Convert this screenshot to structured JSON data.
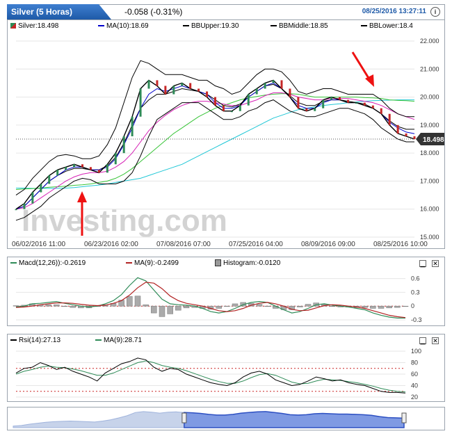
{
  "header": {
    "tab": "Silver (5 Horas)",
    "change": "-0.058 (-0.31%)",
    "datetime": "08/25/2016 13:27:11"
  },
  "main_legend": {
    "price": "Silver:18.498",
    "ma": "MA(10):18.69",
    "bbu": "BBUpper:19.30",
    "bbm": "BBMiddle:18.85",
    "bbl": "BBLower:18.4"
  },
  "macd_legend": {
    "macd": "Macd(12,26)):-0.2619",
    "ma": "MA(9):-0.2499",
    "hist": "Histogram:-0.0120"
  },
  "rsi_legend": {
    "rsi": "Rsi(14):27.13",
    "ma": "MA(9):28.71"
  },
  "watermark": "Investing.com",
  "colors": {
    "accent": "#1e5aa8",
    "price": "#000000",
    "ma10": "#0000cc",
    "bb": "#000000",
    "ma_pink": "#d61fb5",
    "ma_green": "#37c437",
    "ma_cyan": "#1fc7d6",
    "macd": "#2e8b57",
    "macd_signal": "#b22222",
    "arrow": "#ee1111"
  },
  "chart_data": [
    {
      "type": "line",
      "title": "Silver (5 Horas)",
      "last_value": "18.498",
      "ylim": [
        15,
        22
      ],
      "y_ticks": [
        "22.000",
        "21.000",
        "20.000",
        "19.000",
        "18.000",
        "17.000",
        "16.000",
        "15.000"
      ],
      "x_ticks": [
        "06/02/2016 11:00",
        "06/23/2016 02:00",
        "07/08/2016 07:00",
        "07/25/2016 04:00",
        "08/09/2016 09:00",
        "08/25/2016 10:00"
      ],
      "series": [
        {
          "name": "Silver",
          "values": [
            16.0,
            16.2,
            16.6,
            16.9,
            17.2,
            17.4,
            17.5,
            17.6,
            17.5,
            17.4,
            17.3,
            17.6,
            18.0,
            18.6,
            19.3,
            20.3,
            20.6,
            20.4,
            20.1,
            20.4,
            20.5,
            20.3,
            20.2,
            20.0,
            19.7,
            19.5,
            19.5,
            19.7,
            20.1,
            20.3,
            20.5,
            20.6,
            20.3,
            20.0,
            19.6,
            19.5,
            19.6,
            19.9,
            20.0,
            19.9,
            19.8,
            19.8,
            19.7,
            19.6,
            19.4,
            19.0,
            18.7,
            18.6,
            18.5
          ]
        },
        {
          "name": "MA(10)",
          "values": [
            16.0,
            16.1,
            16.4,
            16.7,
            17.0,
            17.2,
            17.4,
            17.5,
            17.5,
            17.4,
            17.4,
            17.5,
            17.8,
            18.3,
            18.9,
            19.6,
            20.1,
            20.3,
            20.2,
            20.3,
            20.4,
            20.3,
            20.2,
            20.1,
            19.8,
            19.6,
            19.6,
            19.7,
            20.0,
            20.2,
            20.4,
            20.5,
            20.3,
            20.0,
            19.7,
            19.6,
            19.6,
            19.8,
            19.9,
            19.9,
            19.8,
            19.8,
            19.7,
            19.6,
            19.4,
            19.1,
            18.9,
            18.75,
            18.69
          ]
        },
        {
          "name": "BBUpper",
          "values": [
            16.5,
            16.7,
            17.1,
            17.4,
            17.7,
            17.9,
            17.95,
            17.9,
            17.8,
            17.8,
            17.9,
            18.3,
            18.9,
            19.8,
            20.7,
            21.3,
            21.2,
            21.0,
            20.8,
            20.8,
            20.8,
            20.7,
            20.6,
            20.6,
            20.4,
            20.3,
            20.1,
            20.2,
            20.5,
            20.8,
            21.0,
            21.0,
            20.9,
            20.6,
            20.2,
            20.1,
            20.2,
            20.3,
            20.3,
            20.2,
            20.1,
            20.1,
            20.1,
            20.1,
            19.9,
            19.6,
            19.4,
            19.3,
            19.3
          ]
        },
        {
          "name": "BBMiddle",
          "values": [
            16.0,
            16.1,
            16.4,
            16.7,
            17.0,
            17.2,
            17.35,
            17.45,
            17.45,
            17.4,
            17.4,
            17.55,
            17.85,
            18.35,
            19.0,
            19.6,
            19.9,
            20.1,
            20.1,
            20.2,
            20.3,
            20.25,
            20.2,
            20.1,
            19.9,
            19.7,
            19.65,
            19.75,
            20.0,
            20.2,
            20.4,
            20.45,
            20.3,
            20.05,
            19.8,
            19.7,
            19.7,
            19.85,
            19.9,
            19.9,
            19.85,
            19.8,
            19.75,
            19.6,
            19.4,
            19.15,
            18.95,
            18.85,
            18.85
          ]
        },
        {
          "name": "BBLower",
          "values": [
            15.6,
            15.7,
            15.9,
            16.1,
            16.4,
            16.6,
            16.8,
            17.0,
            17.1,
            17.05,
            16.9,
            16.9,
            16.9,
            17.0,
            17.3,
            17.9,
            18.6,
            19.2,
            19.4,
            19.6,
            19.8,
            19.8,
            19.8,
            19.6,
            19.4,
            19.2,
            19.2,
            19.3,
            19.5,
            19.6,
            19.8,
            19.9,
            19.7,
            19.5,
            19.4,
            19.3,
            19.3,
            19.4,
            19.5,
            19.6,
            19.6,
            19.5,
            19.4,
            19.2,
            18.9,
            18.7,
            18.5,
            18.4,
            18.4
          ]
        },
        {
          "name": "MA-pink",
          "values": [
            16.0,
            16.05,
            16.2,
            16.4,
            16.6,
            16.8,
            17.0,
            17.15,
            17.25,
            17.3,
            17.3,
            17.35,
            17.5,
            17.7,
            18.0,
            18.4,
            18.8,
            19.1,
            19.35,
            19.55,
            19.7,
            19.8,
            19.85,
            19.85,
            19.8,
            19.75,
            19.7,
            19.7,
            19.8,
            19.9,
            20.05,
            20.15,
            20.15,
            20.1,
            20.0,
            19.95,
            19.9,
            19.9,
            19.95,
            19.95,
            19.95,
            19.9,
            19.85,
            19.8,
            19.7,
            19.55,
            19.4,
            19.3,
            19.2
          ]
        },
        {
          "name": "MA-green",
          "values": [
            16.7,
            16.72,
            16.73,
            16.75,
            16.78,
            16.8,
            16.82,
            16.85,
            16.87,
            16.9,
            16.95,
            17.0,
            17.1,
            17.25,
            17.45,
            17.7,
            17.95,
            18.2,
            18.45,
            18.7,
            18.9,
            19.1,
            19.3,
            19.45,
            19.6,
            19.7,
            19.8,
            19.9,
            19.97,
            20.02,
            20.07,
            20.1,
            20.12,
            20.12,
            20.1,
            20.05,
            20.0,
            20.0,
            20.0,
            20.0,
            20.0,
            20.0,
            19.98,
            19.97,
            19.95,
            19.9,
            19.88,
            19.87,
            19.85
          ]
        },
        {
          "name": "MA-cyan",
          "values": [
            16.75,
            16.75,
            16.74,
            16.74,
            16.74,
            16.74,
            16.75,
            16.77,
            16.8,
            16.83,
            16.86,
            16.9,
            16.95,
            17.0,
            17.05,
            17.1,
            17.2,
            17.3,
            17.4,
            17.5,
            17.6,
            17.75,
            17.9,
            18.05,
            18.2,
            18.35,
            18.5,
            18.65,
            18.8,
            18.95,
            19.1,
            19.25,
            19.35,
            19.45,
            19.55,
            19.6,
            19.65,
            19.7,
            19.73,
            19.76,
            19.8,
            19.82,
            19.85,
            19.87,
            19.88,
            19.89,
            19.9,
            19.9,
            19.9
          ]
        }
      ]
    },
    {
      "type": "line",
      "ylim": [
        -0.3,
        0.7
      ],
      "y_ticks": [
        "0.6",
        "0.3",
        "0",
        "-0.3"
      ],
      "series": [
        {
          "name": "Macd(12,26))",
          "values": [
            -0.02,
            0.0,
            0.05,
            0.06,
            0.08,
            0.1,
            0.06,
            0.03,
            0.0,
            -0.02,
            0.0,
            0.05,
            0.12,
            0.25,
            0.45,
            0.62,
            0.55,
            0.35,
            0.15,
            0.05,
            0.03,
            0.02,
            0.0,
            -0.05,
            -0.12,
            -0.15,
            -0.12,
            -0.05,
            0.03,
            0.08,
            0.1,
            0.08,
            0.0,
            -0.08,
            -0.15,
            -0.12,
            -0.05,
            0.03,
            0.05,
            0.02,
            0.0,
            -0.02,
            -0.05,
            -0.08,
            -0.15,
            -0.2,
            -0.24,
            -0.26,
            -0.26
          ]
        },
        {
          "name": "MA(9)",
          "values": [
            -0.03,
            -0.02,
            0.0,
            0.03,
            0.05,
            0.07,
            0.07,
            0.06,
            0.04,
            0.02,
            0.01,
            0.02,
            0.06,
            0.12,
            0.24,
            0.4,
            0.52,
            0.5,
            0.38,
            0.22,
            0.12,
            0.06,
            0.03,
            0.0,
            -0.05,
            -0.1,
            -0.12,
            -0.1,
            -0.05,
            0.02,
            0.06,
            0.08,
            0.05,
            0.0,
            -0.07,
            -0.1,
            -0.09,
            -0.04,
            0.01,
            0.03,
            0.02,
            0.0,
            -0.02,
            -0.05,
            -0.1,
            -0.15,
            -0.2,
            -0.23,
            -0.25
          ]
        }
      ]
    },
    {
      "type": "line",
      "ylim": [
        20,
        100
      ],
      "y_ticks": [
        "100",
        "80",
        "60",
        "40",
        "20"
      ],
      "ref_lines": [
        30,
        70
      ],
      "series": [
        {
          "name": "Rsi(14)",
          "values": [
            62,
            70,
            72,
            80,
            75,
            68,
            72,
            65,
            60,
            55,
            48,
            62,
            70,
            78,
            82,
            88,
            85,
            72,
            65,
            70,
            68,
            60,
            55,
            50,
            45,
            42,
            40,
            45,
            55,
            62,
            65,
            60,
            50,
            45,
            40,
            42,
            48,
            55,
            52,
            48,
            50,
            45,
            42,
            40,
            35,
            30,
            28,
            28,
            27
          ]
        },
        {
          "name": "MA(9)",
          "values": [
            60,
            65,
            68,
            72,
            74,
            72,
            71,
            69,
            66,
            62,
            58,
            58,
            62,
            68,
            74,
            80,
            83,
            80,
            75,
            72,
            70,
            66,
            61,
            56,
            51,
            47,
            44,
            44,
            48,
            54,
            59,
            61,
            58,
            52,
            46,
            43,
            44,
            48,
            51,
            50,
            49,
            47,
            45,
            42,
            39,
            35,
            32,
            30,
            29
          ]
        }
      ]
    }
  ]
}
